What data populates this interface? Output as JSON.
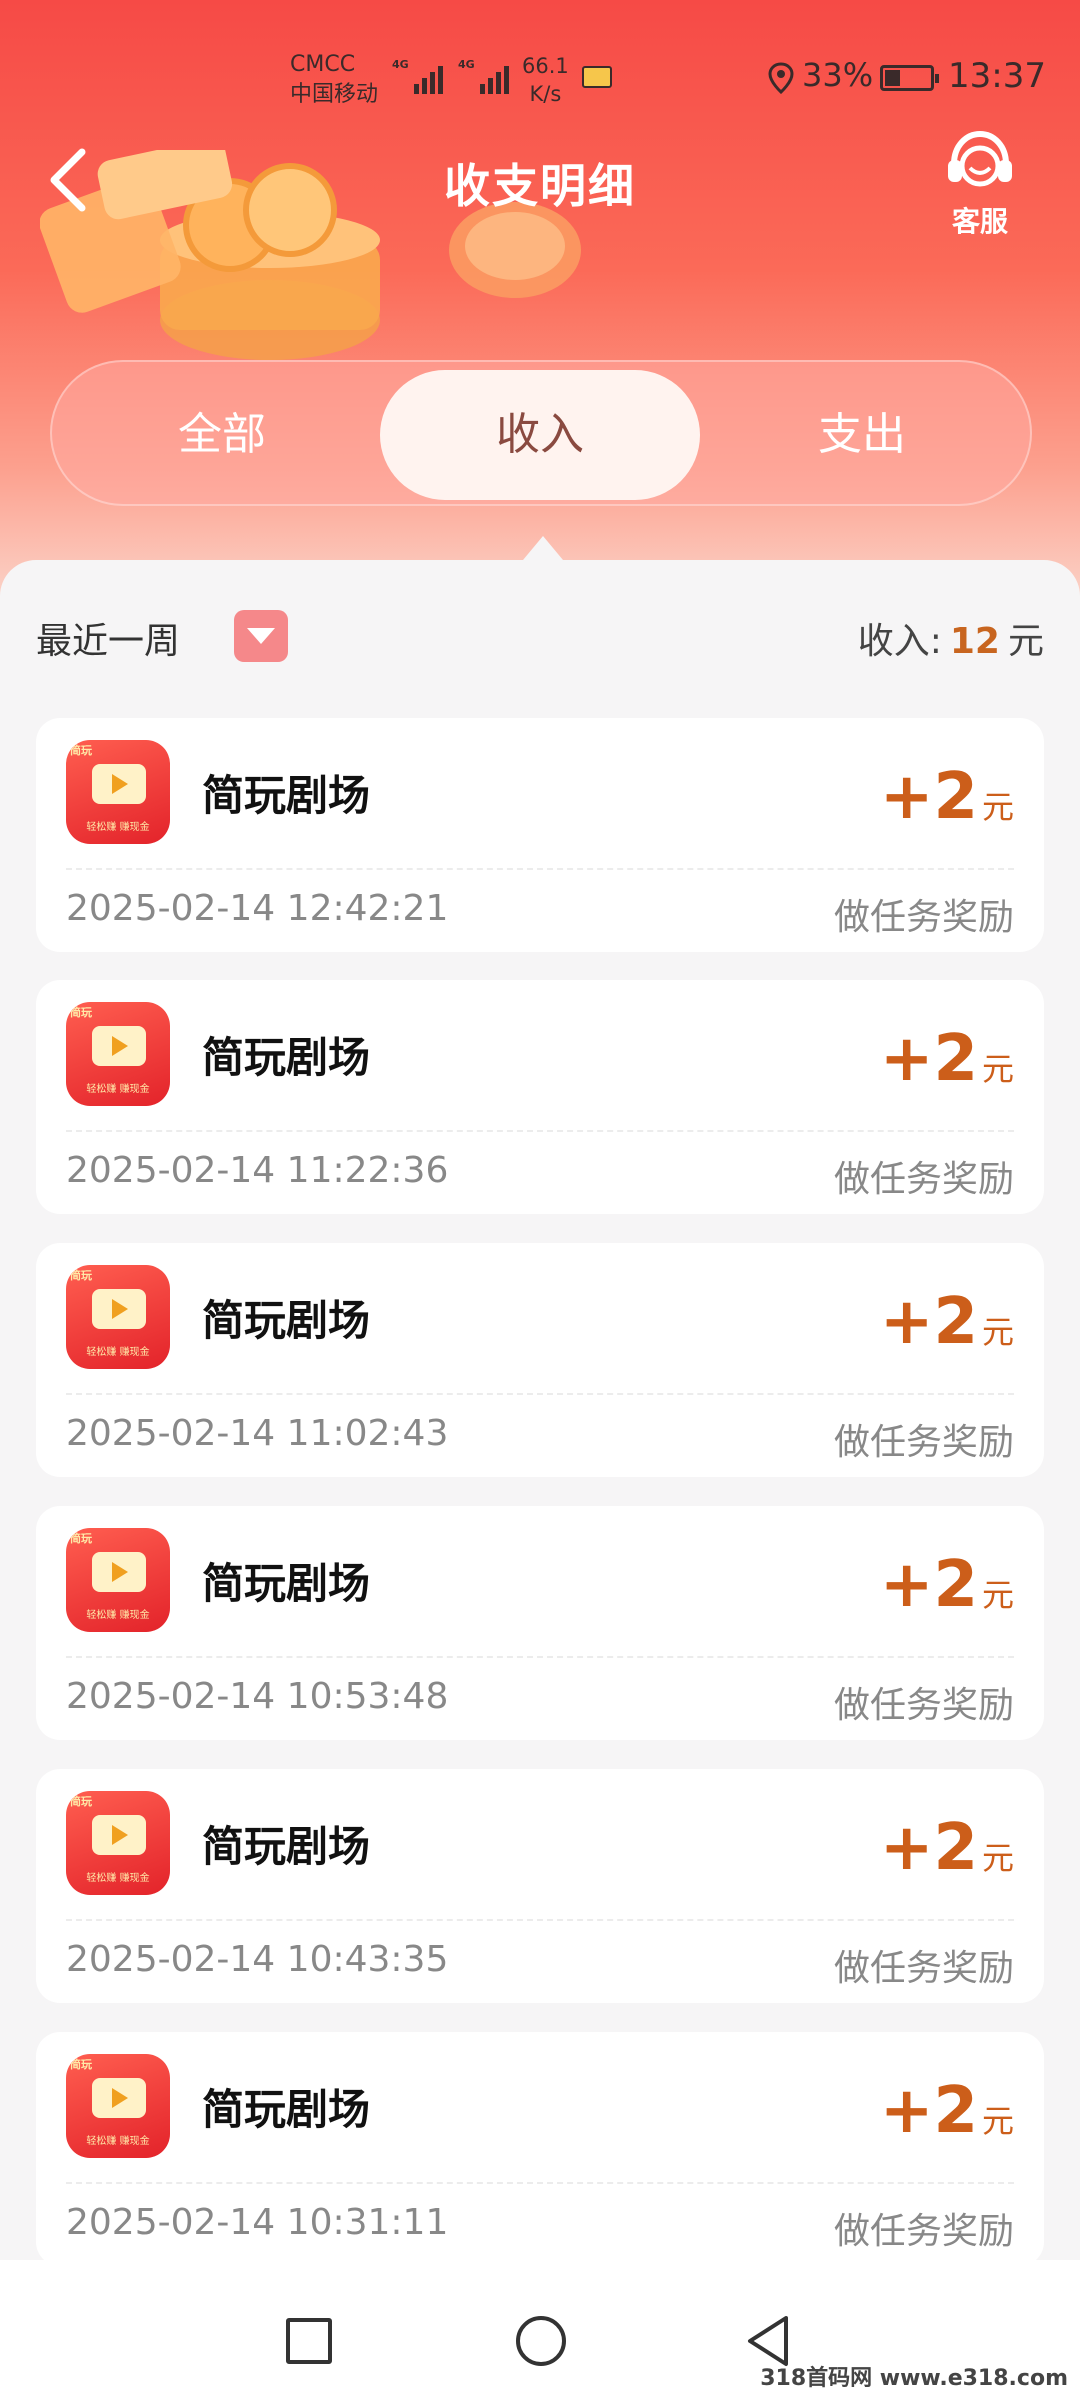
{
  "status_bar": {
    "carrier_line1": "CMCC",
    "carrier_line2": "中国移动",
    "signal_tag": "4G",
    "net_speed_value": "66.1",
    "net_speed_unit": "K/s",
    "battery_percent": "33%",
    "battery_level": 0.33,
    "time": "13:37"
  },
  "header": {
    "title": "收支明细",
    "service_label": "客服"
  },
  "tabs": [
    {
      "label": "全部",
      "selected": false
    },
    {
      "label": "收入",
      "selected": true
    },
    {
      "label": "支出",
      "selected": false
    }
  ],
  "filter": {
    "period": "最近一周",
    "total_label": "收入:",
    "total_value": "12",
    "total_unit": "元"
  },
  "records": [
    {
      "app": "简玩剧场",
      "amount": "+2",
      "unit": "元",
      "time": "2025-02-14 12:42:21",
      "type": "做任务奖励"
    },
    {
      "app": "简玩剧场",
      "amount": "+2",
      "unit": "元",
      "time": "2025-02-14 11:22:36",
      "type": "做任务奖励"
    },
    {
      "app": "简玩剧场",
      "amount": "+2",
      "unit": "元",
      "time": "2025-02-14 11:02:43",
      "type": "做任务奖励"
    },
    {
      "app": "简玩剧场",
      "amount": "+2",
      "unit": "元",
      "time": "2025-02-14 10:53:48",
      "type": "做任务奖励"
    },
    {
      "app": "简玩剧场",
      "amount": "+2",
      "unit": "元",
      "time": "2025-02-14 10:43:35",
      "type": "做任务奖励"
    },
    {
      "app": "简玩剧场",
      "amount": "+2",
      "unit": "元",
      "time": "2025-02-14 10:31:11",
      "type": "做任务奖励"
    }
  ],
  "app_icon": {
    "badge": "简玩",
    "subtitle": "轻松赚 赚现金"
  },
  "watermark": "318首码网 www.e318.com",
  "colors": {
    "header_top": "#f64a46",
    "amount": "#cc5e1a",
    "income_total": "#c8651f",
    "dropdown": "#f5888a"
  }
}
